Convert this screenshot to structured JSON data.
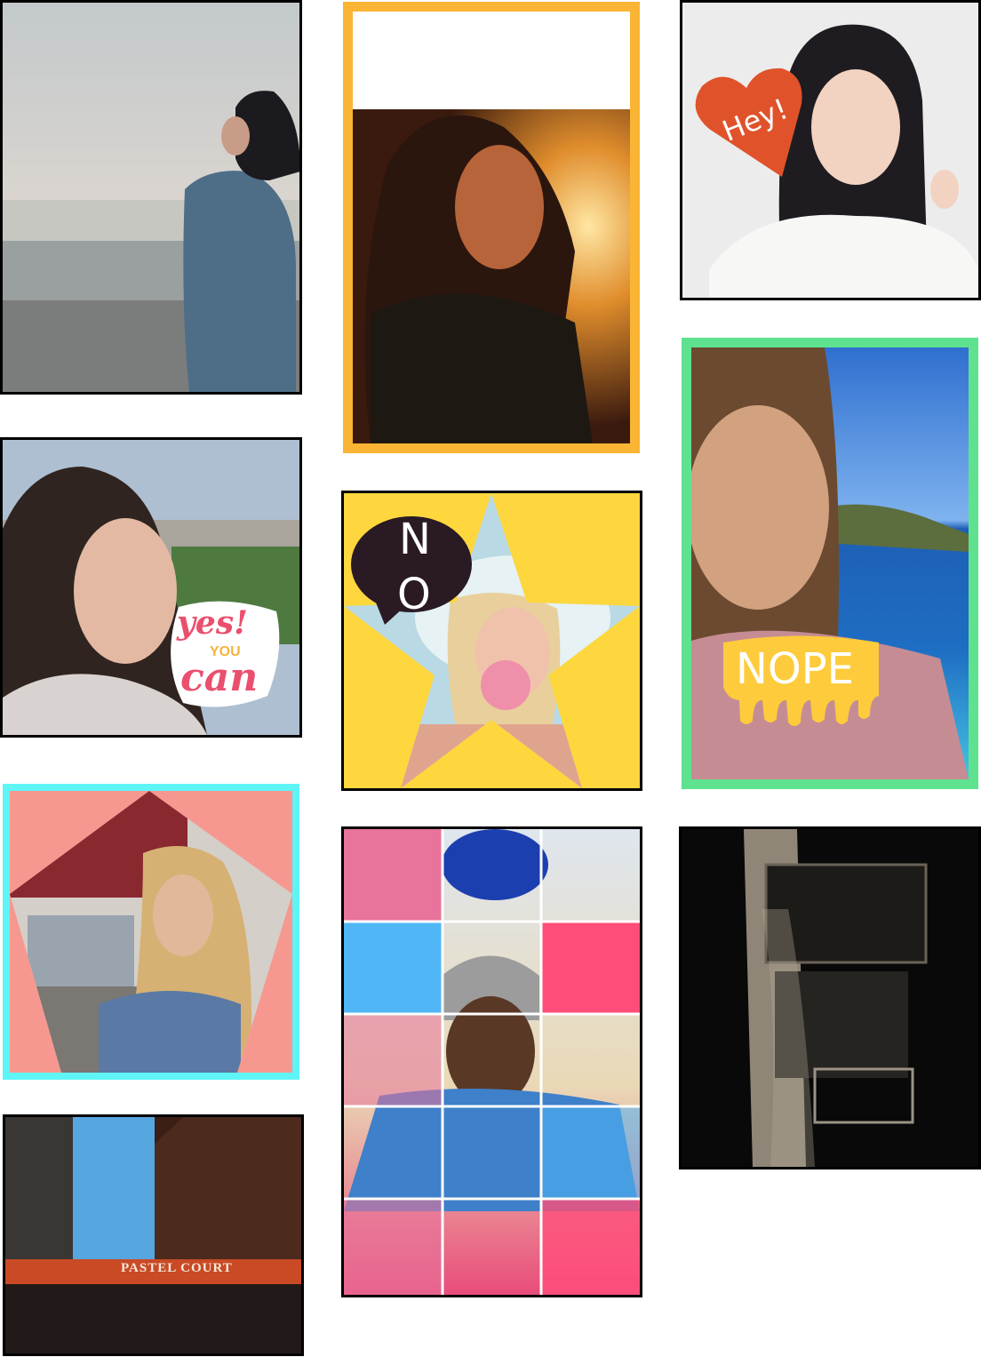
{
  "cards": {
    "card1": {
      "subject": "woman in coat looking at sea"
    },
    "card2": {
      "subject": "smiling woman pointing"
    },
    "card3": {
      "subject": "woman in sunglasses"
    },
    "card4": {
      "subject": "building sign"
    },
    "card5": {
      "subject": "woman at sunset"
    },
    "card6": {
      "subject": "woman blowing bubble"
    },
    "card7": {
      "subject": "man in beanie"
    },
    "card8": {
      "subject": "woman touching hair"
    },
    "card9": {
      "subject": "woman smiling by sea"
    },
    "card10": {
      "subject": "building at night"
    }
  },
  "stickers": {
    "hey": "Hey!",
    "yes": "yes!",
    "you": "YOU",
    "can": "can",
    "no_n": "N",
    "no_o": "O",
    "nope": "NOPE",
    "sign": "PASTEL COURT"
  },
  "colors": {
    "yellow_frame": "#fbb534",
    "green_frame": "#5ee290",
    "cyan_frame": "#5ff5f7",
    "coral_bg": "#f69890",
    "star_bg": "#fdd73d",
    "heart": "#e0522a",
    "bubble": "#2a1a24",
    "drip": "#fdcb3c",
    "grid_pink": "#e8739b",
    "grid_blue": "#50b6f5",
    "grid_hot": "#ff4d7a"
  }
}
